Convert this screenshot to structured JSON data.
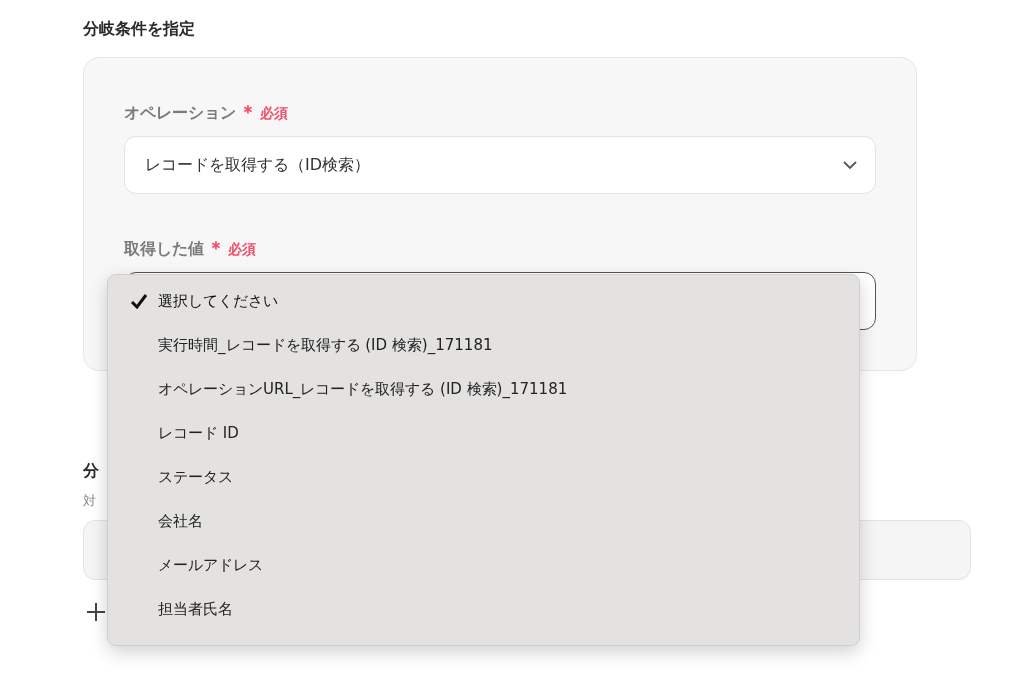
{
  "section_title": "分岐条件を指定",
  "form": {
    "fields": [
      {
        "label": "オペレーション",
        "required_mark": "＊",
        "required_text": "必須",
        "value": "レコードを取得する（ID検索）",
        "focused": false
      },
      {
        "label": "取得した値",
        "required_mark": "＊",
        "required_text": "必須",
        "focused": true
      }
    ]
  },
  "dropdown": {
    "items": [
      {
        "label": "選択してください",
        "selected": true
      },
      {
        "label": "実行時間_レコードを取得する (ID 検索)_171181",
        "selected": false
      },
      {
        "label": "オペレーションURL_レコードを取得する (ID 検索)_171181",
        "selected": false
      },
      {
        "label": "レコード ID",
        "selected": false
      },
      {
        "label": "ステータス",
        "selected": false
      },
      {
        "label": "会社名",
        "selected": false
      },
      {
        "label": "メールアドレス",
        "selected": false
      },
      {
        "label": "担当者氏名",
        "selected": false
      }
    ]
  },
  "lower_section": {
    "title": "分",
    "description": "対"
  }
}
